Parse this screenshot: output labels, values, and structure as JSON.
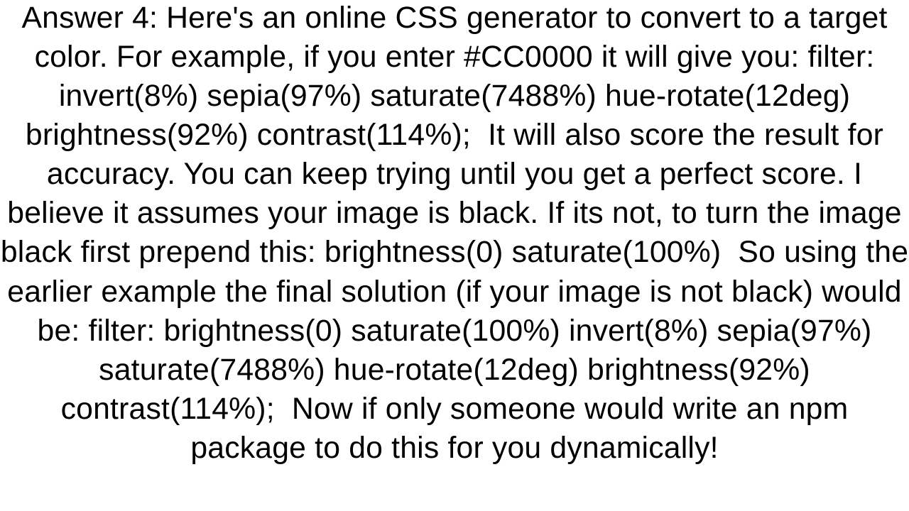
{
  "answer": {
    "text": "Answer 4: Here's an online CSS generator to convert to a target color. For example, if you enter #CC0000 it will give you: filter: invert(8%) sepia(97%) saturate(7488%) hue-rotate(12deg) brightness(92%) contrast(114%);  It will also score the result for accuracy. You can keep trying until you get a perfect score. I believe it assumes your image is black. If its not, to turn the image black first prepend this: brightness(0) saturate(100%)  So using the earlier example the final solution (if your image is not black) would be: filter: brightness(0) saturate(100%) invert(8%) sepia(97%) saturate(7488%) hue-rotate(12deg) brightness(92%) contrast(114%);  Now if only someone would write an npm package to do this for you dynamically!"
  }
}
